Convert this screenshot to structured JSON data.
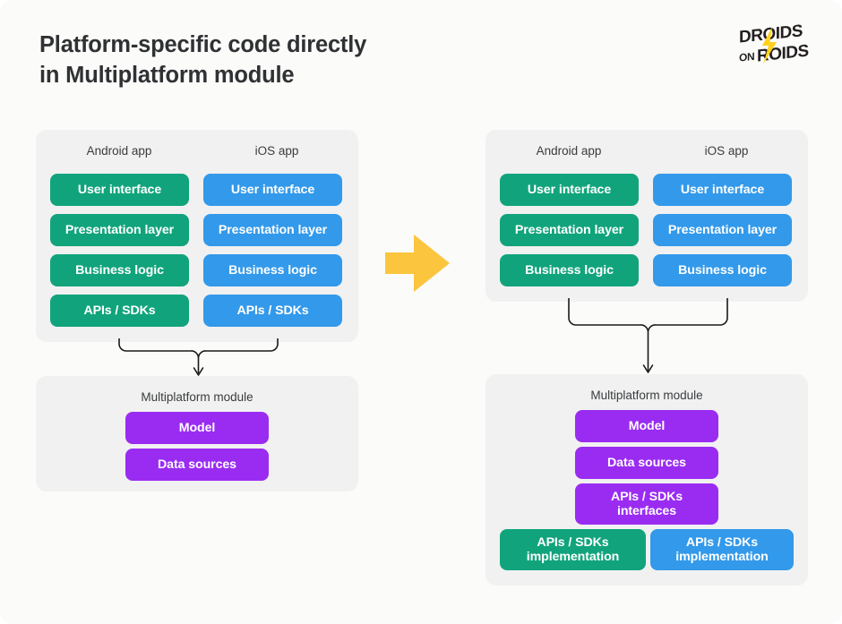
{
  "title": "Platform-specific code directly\nin Multiplatform module",
  "logo": {
    "line1": "DROIDS",
    "line2_a": "ON",
    "line2_b": "ROIDS",
    "bolt_color": "#ffd21e",
    "text_color": "#231f20"
  },
  "colors": {
    "page_background": "#fbfbfa",
    "panel_background": "#f1f1f1",
    "android_green": "#11a47c",
    "ios_blue": "#3399ea",
    "shared_purple": "#9a2cf2",
    "arrow_yellow": "#fbc53d",
    "connector_stroke": "#1a1a1a",
    "caption_text": "#3a3c3e",
    "title_text": "#2f3133"
  },
  "transition_arrow": {
    "name": "transforms-into",
    "color": "#fbc53d"
  },
  "before": {
    "apps_panel": {
      "columns": [
        {
          "caption": "Android app",
          "color": "green",
          "layers": [
            "User interface",
            "Presentation layer",
            "Business logic",
            "APIs / SDKs"
          ]
        },
        {
          "caption": "iOS app",
          "color": "blue",
          "layers": [
            "User interface",
            "Presentation layer",
            "Business logic",
            "APIs / SDKs"
          ]
        }
      ]
    },
    "module_panel": {
      "caption": "Multiplatform module",
      "shared_blocks": [
        "Model",
        "Data sources"
      ]
    }
  },
  "after": {
    "apps_panel": {
      "columns": [
        {
          "caption": "Android app",
          "color": "green",
          "layers": [
            "User interface",
            "Presentation layer",
            "Business logic"
          ]
        },
        {
          "caption": "iOS app",
          "color": "blue",
          "layers": [
            "User interface",
            "Presentation layer",
            "Business logic"
          ]
        }
      ]
    },
    "module_panel": {
      "caption": "Multiplatform module",
      "shared_blocks": [
        "Model",
        "Data sources",
        "APIs / SDKs\ninterfaces"
      ],
      "platform_blocks": [
        {
          "label": "APIs / SDKs\nimplementation",
          "color": "green"
        },
        {
          "label": "APIs / SDKs\nimplementation",
          "color": "blue"
        }
      ]
    }
  }
}
